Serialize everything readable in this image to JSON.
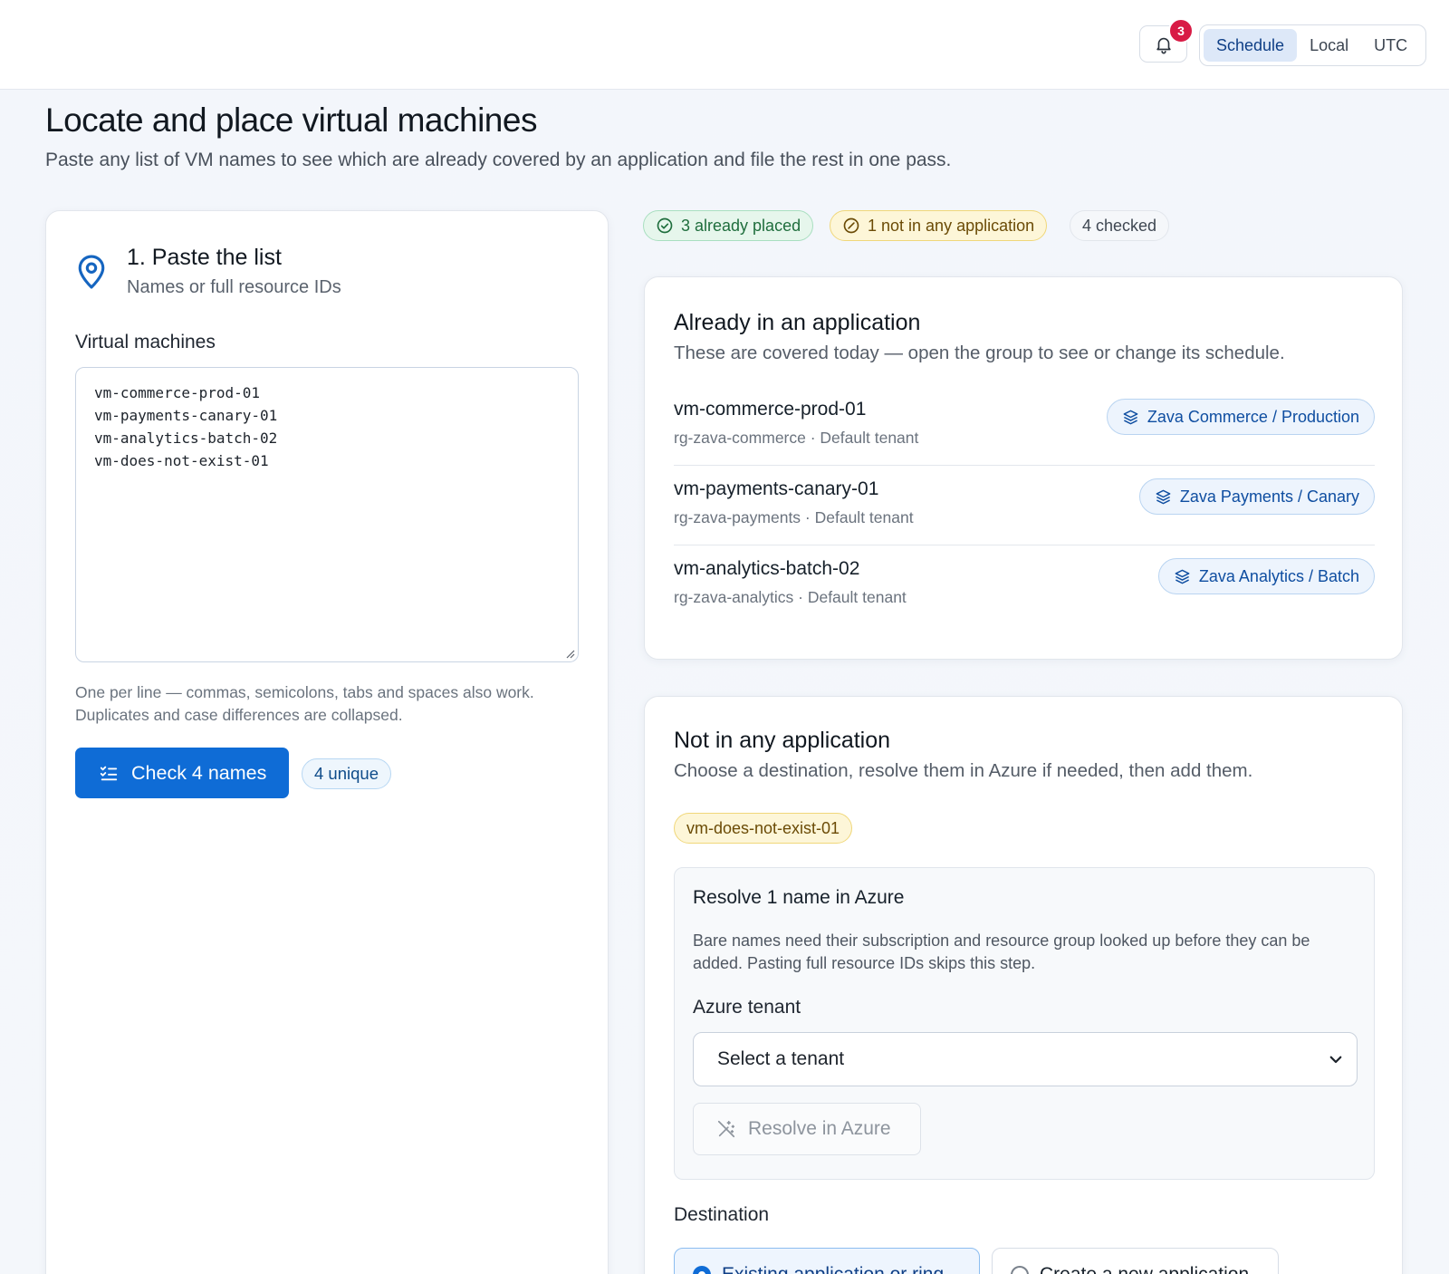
{
  "topbar": {
    "notification_count": "3",
    "tz_options": [
      "Schedule",
      "Local",
      "UTC"
    ],
    "tz_selected": "Schedule"
  },
  "header": {
    "title": "Locate and place virtual machines",
    "subtitle": "Paste any list of VM names to see which are already covered by an application and file the rest in one pass."
  },
  "paste": {
    "step_title": "1. Paste the list",
    "step_subtitle": "Names or full resource IDs",
    "field_label": "Virtual machines",
    "value": "vm-commerce-prod-01\nvm-payments-canary-01\nvm-analytics-batch-02\nvm-does-not-exist-01",
    "hint_line1": "One per line — commas, semicolons, tabs and spaces also work.",
    "hint_line2": "Duplicates and case differences are collapsed.",
    "check_button": "Check 4 names",
    "unique_badge": "4 unique"
  },
  "summary": {
    "placed": "3 already placed",
    "not_placed": "1 not in any application",
    "checked": "4 checked"
  },
  "applied": {
    "title": "Already in an application",
    "subtitle": "These are covered today — open the group to see or change its schedule.",
    "rows": [
      {
        "name": "vm-commerce-prod-01",
        "meta": "rg-zava-commerce · Default tenant",
        "app": "Zava Commerce / Production"
      },
      {
        "name": "vm-payments-canary-01",
        "meta": "rg-zava-payments · Default tenant",
        "app": "Zava Payments / Canary"
      },
      {
        "name": "vm-analytics-batch-02",
        "meta": "rg-zava-analytics · Default tenant",
        "app": "Zava Analytics / Batch"
      }
    ]
  },
  "unplaced": {
    "title": "Not in any application",
    "subtitle": "Choose a destination, resolve them in Azure if needed, then add them.",
    "vm_chip": "vm-does-not-exist-01",
    "resolve": {
      "title": "Resolve 1 name in Azure",
      "description": "Bare names need their subscription and resource group looked up before they can be added. Pasting full resource IDs skips this step.",
      "tenant_label": "Azure tenant",
      "tenant_value": "Select a tenant",
      "button": "Resolve in Azure"
    },
    "destination": {
      "label": "Destination",
      "option_existing": "Existing application or ring",
      "option_new": "Create a new application",
      "selected": "Existing application or ring"
    }
  },
  "colors": {
    "primary": "#0f6cd6",
    "badge_red": "#d81b45",
    "success": "#1f6e3d",
    "warning": "#6b4b06"
  }
}
